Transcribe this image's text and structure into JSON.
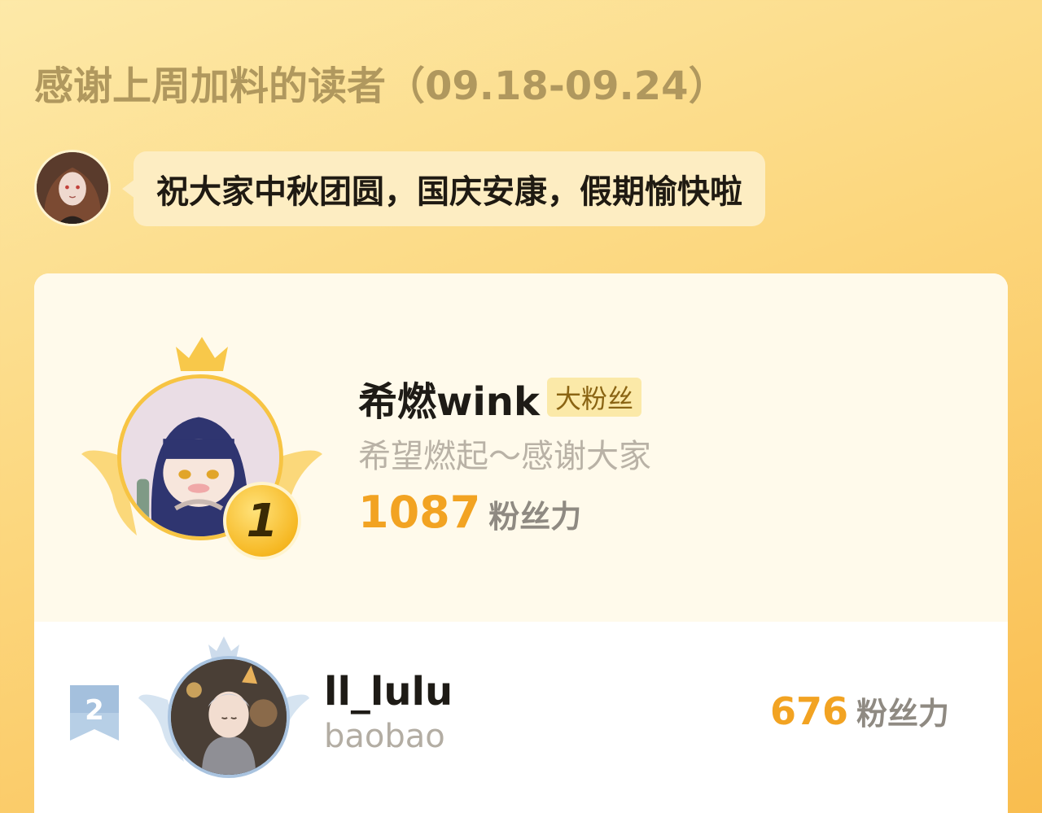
{
  "header": {
    "title": "感谢上周加料的读者（09.18-09.24）"
  },
  "greeting": {
    "message": "祝大家中秋团圆，国庆安康，假期愉快啦"
  },
  "leaderboard": [
    {
      "rank": "1",
      "name": "希燃wink",
      "tag": "大粉丝",
      "signature": "希望燃起～感谢大家",
      "score": "1087",
      "score_unit": "粉丝力"
    },
    {
      "rank": "2",
      "name": "ll_lulu",
      "signature": "baobao",
      "score": "676",
      "score_unit": "粉丝力"
    }
  ],
  "colors": {
    "background": "#fcd77e",
    "title": "#b0985e",
    "score": "#f2a322",
    "gold": "#f7c443",
    "silver": "#a9c3df"
  }
}
